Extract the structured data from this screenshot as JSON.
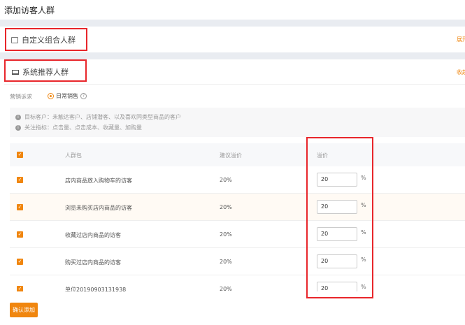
{
  "page_title": "添加访客人群",
  "custom_section": {
    "title": "自定义组合人群",
    "toggle": "展开"
  },
  "system_section": {
    "title": "系统推荐人群",
    "toggle": "收起"
  },
  "marketing": {
    "label": "营销诉求",
    "option": "日常销售",
    "selected": true
  },
  "info": {
    "target": "目标客户：未触达客户、店铺潜客、以及喜欢同类型商品的客户",
    "metrics": "关注指标：点击量、点击成本、收藏量、加购量"
  },
  "table": {
    "headers": {
      "name": "人群包",
      "suggested": "建议溢价",
      "premium": "溢价"
    },
    "unit": "%",
    "rows": [
      {
        "name": "店内商品放入购物车的访客",
        "suggested": "20%",
        "premium": "20",
        "checked": true
      },
      {
        "name": "浏览未购买店内商品的访客",
        "suggested": "20%",
        "premium": "20",
        "checked": true
      },
      {
        "name": "收藏过店内商品的访客",
        "suggested": "20%",
        "premium": "20",
        "checked": true
      },
      {
        "name": "购买过店内商品的访客",
        "suggested": "20%",
        "premium": "20",
        "checked": true
      },
      {
        "name": "单位20190903131938",
        "suggested": "20%",
        "premium": "20",
        "checked": true
      }
    ]
  },
  "confirm_button": "确认添加",
  "colors": {
    "accent": "#f0860f",
    "highlight": "#e8262b"
  }
}
